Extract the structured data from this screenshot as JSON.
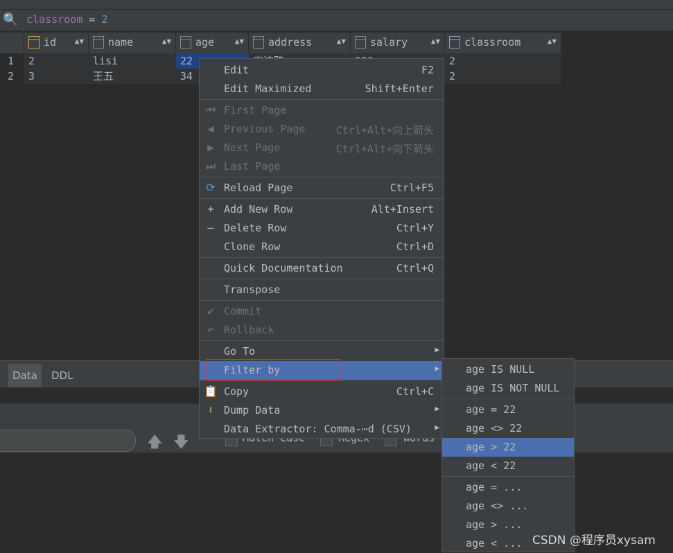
{
  "filter": {
    "keyword": "classroom",
    "operator": "=",
    "value": "2"
  },
  "columns": [
    {
      "name": "id"
    },
    {
      "name": "name"
    },
    {
      "name": "age"
    },
    {
      "name": "address"
    },
    {
      "name": "salary"
    },
    {
      "name": "classroom"
    }
  ],
  "rows": [
    {
      "num": "1",
      "id": "2",
      "name": "lisi",
      "age": "22",
      "address": "高流路",
      "salary": "200",
      "classroom": "2"
    },
    {
      "num": "2",
      "id": "3",
      "name": "王五",
      "age": "34",
      "address": "",
      "salary": "",
      "classroom": "2"
    }
  ],
  "tabs": [
    "Data",
    "DDL"
  ],
  "search": {
    "options": [
      "Match Case",
      "Regex",
      "Words"
    ]
  },
  "context_menu": {
    "edit": {
      "label": "Edit",
      "shortcut": "F2"
    },
    "edit_maximized": {
      "label": "Edit Maximized",
      "shortcut": "Shift+Enter"
    },
    "first_page": {
      "label": "First Page",
      "shortcut": ""
    },
    "previous_page": {
      "label": "Previous Page",
      "shortcut": "Ctrl+Alt+向上箭头"
    },
    "next_page": {
      "label": "Next Page",
      "shortcut": "Ctrl+Alt+向下箭头"
    },
    "last_page": {
      "label": "Last Page",
      "shortcut": ""
    },
    "reload_page": {
      "label": "Reload Page",
      "shortcut": "Ctrl+F5"
    },
    "add_row": {
      "label": "Add New Row",
      "shortcut": "Alt+Insert"
    },
    "delete_row": {
      "label": "Delete Row",
      "shortcut": "Ctrl+Y"
    },
    "clone_row": {
      "label": "Clone Row",
      "shortcut": "Ctrl+D"
    },
    "quick_doc": {
      "label": "Quick Documentation",
      "shortcut": "Ctrl+Q"
    },
    "transpose": {
      "label": "Transpose"
    },
    "commit": {
      "label": "Commit"
    },
    "rollback": {
      "label": "Rollback"
    },
    "go_to": {
      "label": "Go To"
    },
    "filter_by": {
      "label": "Filter by"
    },
    "copy": {
      "label": "Copy",
      "shortcut": "Ctrl+C"
    },
    "dump_data": {
      "label": "Dump Data"
    },
    "data_extractor": {
      "label": "Data Extractor: Comma-⋯d (CSV)"
    }
  },
  "filter_submenu": [
    "age IS NULL",
    "age IS NOT NULL",
    "age = 22",
    "age <> 22",
    "age > 22",
    "age < 22",
    "age = ...",
    "age <> ...",
    "age > ...",
    "age < ..."
  ],
  "watermark": "CSDN @程序员xysam",
  "icons": {
    "search": "magnifier-icon",
    "reload": "reload-icon",
    "add": "plus-icon",
    "delete": "minus-icon",
    "commit": "check-icon",
    "rollback": "undo-icon",
    "copy": "copy-icon",
    "dump": "download-icon"
  },
  "colors": {
    "highlight": "#4b6eaf",
    "background": "#2b2b2b",
    "panel": "#3c3f41",
    "selected_cell": "#214283"
  }
}
